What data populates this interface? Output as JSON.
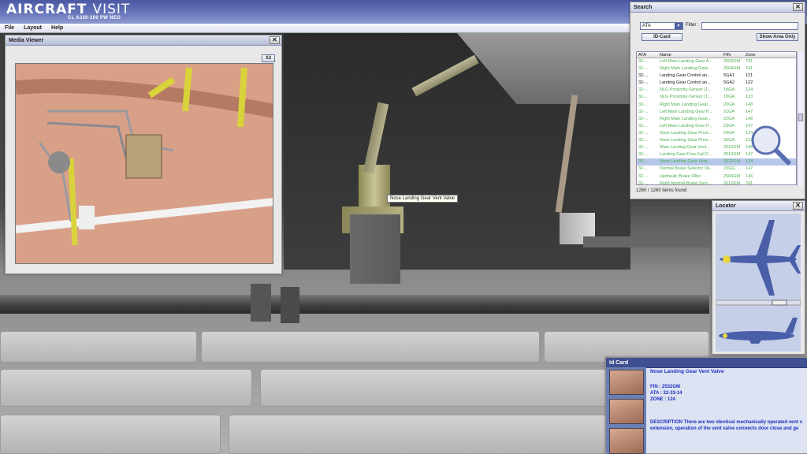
{
  "app": {
    "title_strong": "AIRCRAFT",
    "title_light": "VISIT",
    "subtitle": "CL A320-200 PW NEO"
  },
  "menu": [
    "File",
    "Layout",
    "Help"
  ],
  "media_viewer": {
    "title": "Media Viewer",
    "close": "✕",
    "zoom_label": "X2"
  },
  "tooltip": "Nose Landing Gear Vent Valve",
  "search": {
    "title": "Search",
    "close": "✕",
    "dropdown_value": "ATA",
    "filter_label": "Filter :",
    "filter_value": "",
    "id_card_button": "ID-Card",
    "show_area_button": "Show Area Only",
    "columns": [
      "ATA",
      "Name",
      "FIN",
      "Zone"
    ],
    "rows": [
      {
        "ata": "32-...",
        "name": "Left Main Landing Gear A...",
        "fin": "2503GM",
        "zone": "731",
        "style": "g"
      },
      {
        "ata": "32-...",
        "name": "Right Main Landing Gear...",
        "fin": "2504GM",
        "zone": "741",
        "style": "g"
      },
      {
        "ata": "32-...",
        "name": "Landing Gear Control an...",
        "fin": "5GA1",
        "zone": "121",
        "style": "k"
      },
      {
        "ata": "32-...",
        "name": "Landing Gear Control an...",
        "fin": "5GA2",
        "zone": "122",
        "style": "k"
      },
      {
        "ata": "32-...",
        "name": "NLG Proximity-Sensor (1...",
        "fin": "18GA",
        "zone": "124",
        "style": "g"
      },
      {
        "ata": "32-...",
        "name": "NLG Proximity-Sensor (1...",
        "fin": "19GA",
        "zone": "123",
        "style": "g"
      },
      {
        "ata": "32-...",
        "name": "Right Main Landing Gear...",
        "fin": "20GA",
        "zone": "148",
        "style": "g"
      },
      {
        "ata": "32-...",
        "name": "Left Main Landing Gear P...",
        "fin": "21GA",
        "zone": "147",
        "style": "g"
      },
      {
        "ata": "32-...",
        "name": "Right Main Landing Gear...",
        "fin": "22GA",
        "zone": "148",
        "style": "g"
      },
      {
        "ata": "32-...",
        "name": "Left Main Landing Gear P...",
        "fin": "23GA",
        "zone": "147",
        "style": "g"
      },
      {
        "ata": "32-...",
        "name": "Nose Landing Gear Proxi...",
        "fin": "24GA",
        "zone": "124",
        "style": "g"
      },
      {
        "ata": "32-...",
        "name": "Nose Landing Gear Proxi...",
        "fin": "25GA",
        "zone": "123",
        "style": "g"
      },
      {
        "ata": "32-...",
        "name": "Main Landing Gear Vent...",
        "fin": "2516GM",
        "zone": "148",
        "style": "g"
      },
      {
        "ata": "32-...",
        "name": "Landing Gear Free-Fall C...",
        "fin": "2519GM",
        "zone": "147",
        "style": "g"
      },
      {
        "ata": "32-...",
        "name": "Nose Landing Gear Vent...",
        "fin": "2532GM",
        "zone": "124",
        "style": "sel"
      },
      {
        "ata": "32-...",
        "name": "Normal Brake Selector Va...",
        "fin": "23GG",
        "zone": "147",
        "style": "g"
      },
      {
        "ata": "32-...",
        "name": "Hydraulic Brake Filter",
        "fin": "2584GM",
        "zone": "146",
        "style": "g"
      },
      {
        "ata": "32-...",
        "name": "Right Normal-Brake Serv...",
        "fin": "2612GM",
        "zone": "741",
        "style": "g"
      }
    ],
    "count": "1260 / 1260 items found"
  },
  "locator": {
    "title": "Locator",
    "close": "✕"
  },
  "id_card": {
    "title": "Id Card",
    "name": "Nose Landing Gear Vent Valve",
    "fin": "FIN : 2532GM",
    "ata": "ATA : 32-33-14",
    "zone": "ZONE : 124",
    "description_line1": "DESCRIPTION There are two identical mechanically operated vent v",
    "description_line2": "extension, operation of the vent valve connects door close and ge"
  },
  "colors": {
    "header_blue": "#5b68b0",
    "list_green": "#4caf50",
    "selection": "#b7c7ea",
    "id_text_blue": "#1f2fbf",
    "aircraft_silhouette": "#4a5fa8"
  }
}
